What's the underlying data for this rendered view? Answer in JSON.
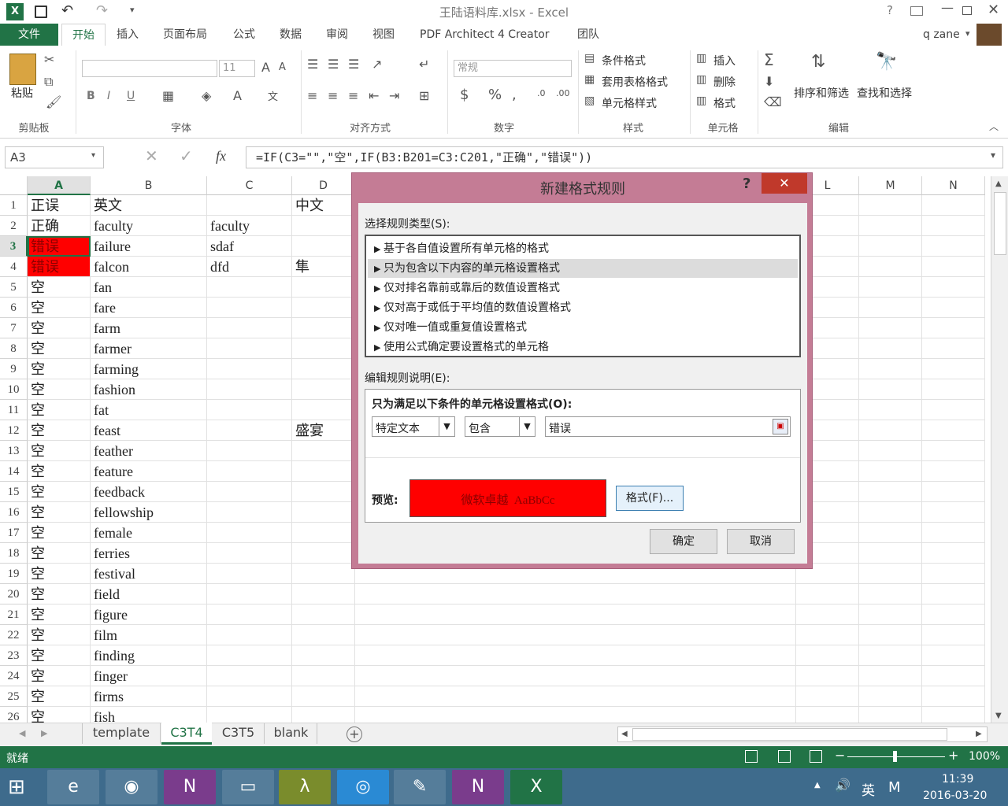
{
  "window": {
    "title": "王陆语料库.xlsx - Excel",
    "user": "q zane",
    "help": "?"
  },
  "tabs": [
    "文件",
    "开始",
    "插入",
    "页面布局",
    "公式",
    "数据",
    "审阅",
    "视图",
    "PDF Architect 4 Creator",
    "团队"
  ],
  "ribbon": {
    "paste": "粘贴",
    "clipboard": "剪贴板",
    "font_size": "11",
    "font": "字体",
    "align": "对齐方式",
    "numfmt": "常规",
    "number": "数字",
    "cond": "条件格式",
    "tablefmt": "套用表格格式",
    "cellstyle": "单元格样式",
    "styles": "样式",
    "insert": "插入",
    "delete": "删除",
    "format": "格式",
    "cells": "单元格",
    "sort": "排序和筛选",
    "find": "查找和选择",
    "editing": "编辑",
    "bold": "B",
    "italic": "I",
    "underline": "U",
    "wen": "wén\n文"
  },
  "formula_bar": {
    "namebox": "A3",
    "fx": "fx",
    "formula": "=IF(C3=\"\",\"空\",IF(B3:B201=C3:C201,\"正确\",\"错误\"))"
  },
  "columns": [
    "A",
    "B",
    "C",
    "D",
    "L",
    "M",
    "N"
  ],
  "rows": [
    {
      "n": "1",
      "a": "正误",
      "b": "英文",
      "c": "",
      "d": "中文"
    },
    {
      "n": "2",
      "a": "正确",
      "b": "faculty",
      "c": "faculty",
      "d": ""
    },
    {
      "n": "3",
      "a": "错误",
      "b": "failure",
      "c": "sdaf",
      "d": ""
    },
    {
      "n": "4",
      "a": "错误",
      "b": "falcon",
      "c": "dfd",
      "d": "隼"
    },
    {
      "n": "5",
      "a": "空",
      "b": "fan",
      "c": "",
      "d": ""
    },
    {
      "n": "6",
      "a": "空",
      "b": "fare",
      "c": "",
      "d": ""
    },
    {
      "n": "7",
      "a": "空",
      "b": "farm",
      "c": "",
      "d": ""
    },
    {
      "n": "8",
      "a": "空",
      "b": "farmer",
      "c": "",
      "d": ""
    },
    {
      "n": "9",
      "a": "空",
      "b": "farming",
      "c": "",
      "d": ""
    },
    {
      "n": "10",
      "a": "空",
      "b": "fashion",
      "c": "",
      "d": ""
    },
    {
      "n": "11",
      "a": "空",
      "b": "fat",
      "c": "",
      "d": ""
    },
    {
      "n": "12",
      "a": "空",
      "b": "feast",
      "c": "",
      "d": "盛宴"
    },
    {
      "n": "13",
      "a": "空",
      "b": "feather",
      "c": "",
      "d": ""
    },
    {
      "n": "14",
      "a": "空",
      "b": "feature",
      "c": "",
      "d": ""
    },
    {
      "n": "15",
      "a": "空",
      "b": "feedback",
      "c": "",
      "d": ""
    },
    {
      "n": "16",
      "a": "空",
      "b": "fellowship",
      "c": "",
      "d": ""
    },
    {
      "n": "17",
      "a": "空",
      "b": "female",
      "c": "",
      "d": ""
    },
    {
      "n": "18",
      "a": "空",
      "b": "ferries",
      "c": "",
      "d": ""
    },
    {
      "n": "19",
      "a": "空",
      "b": "festival",
      "c": "",
      "d": ""
    },
    {
      "n": "20",
      "a": "空",
      "b": "field",
      "c": "",
      "d": ""
    },
    {
      "n": "21",
      "a": "空",
      "b": "figure",
      "c": "",
      "d": ""
    },
    {
      "n": "22",
      "a": "空",
      "b": "film",
      "c": "",
      "d": ""
    },
    {
      "n": "23",
      "a": "空",
      "b": "finding",
      "c": "",
      "d": ""
    },
    {
      "n": "24",
      "a": "空",
      "b": "finger",
      "c": "",
      "d": ""
    },
    {
      "n": "25",
      "a": "空",
      "b": "firms",
      "c": "",
      "d": ""
    },
    {
      "n": "26",
      "a": "空",
      "b": "fish",
      "c": "",
      "d": ""
    }
  ],
  "dialog": {
    "title": "新建格式规则",
    "help": "?",
    "select_label": "选择规则类型(S):",
    "rule_types": [
      "基于各自值设置所有单元格的格式",
      "只为包含以下内容的单元格设置格式",
      "仅对排名靠前或靠后的数值设置格式",
      "仅对高于或低于平均值的数值设置格式",
      "仅对唯一值或重复值设置格式",
      "使用公式确定要设置格式的单元格"
    ],
    "edit_label": "编辑规则说明(E):",
    "cond_label": "只为满足以下条件的单元格设置格式(O):",
    "dd1": "特定文本",
    "dd2": "包含",
    "value": "错误",
    "preview_label": "预览:",
    "preview_text": "微软卓越  AaBbCc",
    "format_btn": "格式(F)...",
    "ok": "确定",
    "cancel": "取消"
  },
  "sheets": [
    "template",
    "C3T4",
    "C3T5",
    "blank"
  ],
  "status": {
    "ready": "就绪",
    "zoom": "100%"
  },
  "taskbar": {
    "lang": "英",
    "ime": "M",
    "time": "11:39",
    "date": "2016-03-20"
  },
  "colors": {
    "accent": "#217346",
    "error_fill": "#ff0000",
    "dialog_frame": "#c47c95"
  }
}
